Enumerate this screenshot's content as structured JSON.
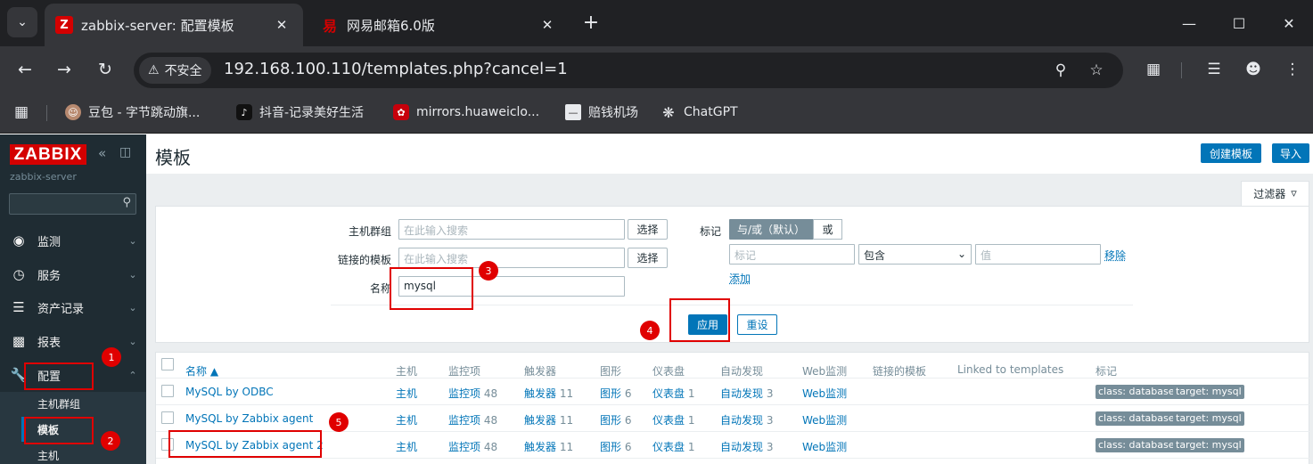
{
  "browser": {
    "tabs": [
      {
        "title": "zabbix-server: 配置模板",
        "favicon": "Z",
        "active": true
      },
      {
        "title": "网易邮箱6.0版",
        "favicon": "易",
        "active": false
      }
    ],
    "new_tab": "+",
    "security_label": "不安全",
    "url": "192.168.100.110/templates.php?cancel=1",
    "bookmarks": [
      {
        "label": "豆包 - 字节跳动旗...",
        "icon": "doubao-icon"
      },
      {
        "label": "抖音-记录美好生活",
        "icon": "douyin-icon"
      },
      {
        "label": "mirrors.huaweiclo...",
        "icon": "huawei-icon"
      },
      {
        "label": "赔钱机场",
        "icon": "site-icon"
      },
      {
        "label": "ChatGPT",
        "icon": "chatgpt-icon"
      }
    ]
  },
  "sidebar": {
    "logo": "ZABBIX",
    "server_name": "zabbix-server",
    "menu": [
      {
        "label": "监测",
        "icon": "eye-icon"
      },
      {
        "label": "服务",
        "icon": "clock-icon"
      },
      {
        "label": "资产记录",
        "icon": "list-icon"
      },
      {
        "label": "报表",
        "icon": "chart-icon"
      },
      {
        "label": "配置",
        "icon": "wrench-icon"
      }
    ],
    "submenu": [
      "主机群组",
      "模板",
      "主机"
    ]
  },
  "page": {
    "title": "模板",
    "create_button": "创建模板",
    "import_button": "导入"
  },
  "filter": {
    "tab_label": "过滤器",
    "host_group_label": "主机群组",
    "host_group_placeholder": "在此输入搜索",
    "linked_label": "链接的模板",
    "linked_placeholder": "在此输入搜索",
    "select_button": "选择",
    "name_label": "名称",
    "name_value": "mysql",
    "tags_label": "标记",
    "tag_and_or": "与/或（默认）",
    "tag_or": "或",
    "tag_placeholder": "标记",
    "tag_operator": "包含",
    "value_placeholder": "值",
    "remove_link": "移除",
    "add_link": "添加",
    "apply_button": "应用",
    "reset_button": "重设"
  },
  "table": {
    "headers": [
      "名称 ▲",
      "主机",
      "监控项",
      "触发器",
      "图形",
      "仪表盘",
      "自动发现",
      "Web监测",
      "链接的模板",
      "Linked to templates",
      "标记"
    ],
    "rows": [
      {
        "name": "MySQL by ODBC",
        "hosts": "主机",
        "items": "监控项",
        "items_n": "48",
        "triggers": "触发器",
        "triggers_n": "11",
        "graphs": "图形",
        "graphs_n": "6",
        "dash": "仪表盘",
        "dash_n": "1",
        "disc": "自动发现",
        "disc_n": "3",
        "web": "Web监测",
        "tag1": "class: database",
        "tag2": "target: mysql"
      },
      {
        "name": "MySQL by Zabbix agent",
        "hosts": "主机",
        "items": "监控项",
        "items_n": "48",
        "triggers": "触发器",
        "triggers_n": "11",
        "graphs": "图形",
        "graphs_n": "6",
        "dash": "仪表盘",
        "dash_n": "1",
        "disc": "自动发现",
        "disc_n": "3",
        "web": "Web监测",
        "tag1": "class: database",
        "tag2": "target: mysql"
      },
      {
        "name": "MySQL by Zabbix agent 2",
        "hosts": "主机",
        "items": "监控项",
        "items_n": "48",
        "triggers": "触发器",
        "triggers_n": "11",
        "graphs": "图形",
        "graphs_n": "6",
        "dash": "仪表盘",
        "dash_n": "1",
        "disc": "自动发现",
        "disc_n": "3",
        "web": "Web监测",
        "tag1": "class: database",
        "tag2": "target: mysql"
      }
    ]
  },
  "annotations": [
    "1",
    "2",
    "3",
    "4",
    "5"
  ],
  "colors": {
    "zabbix_red": "#d40000",
    "sidebar": "#1f2c33",
    "link": "#0275b8",
    "annotation": "#e00000"
  }
}
